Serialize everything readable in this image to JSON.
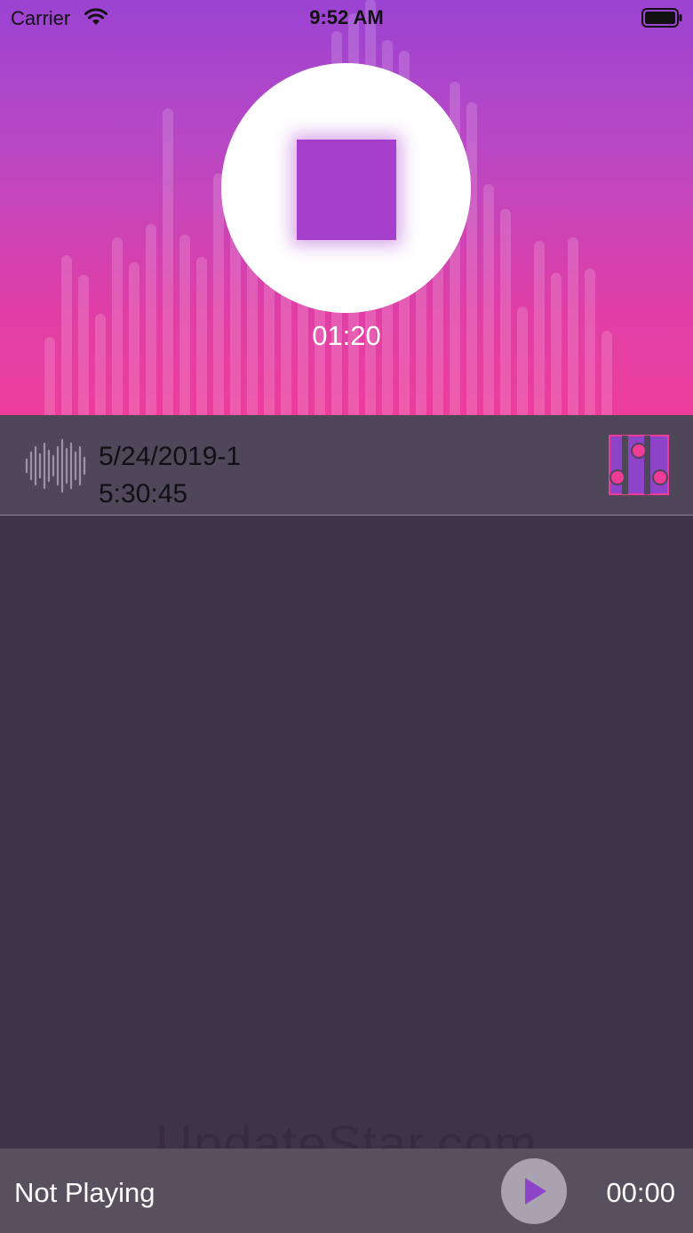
{
  "status_bar": {
    "carrier": "Carrier",
    "time": "9:52 AM",
    "icons": [
      "wifi-icon",
      "battery-icon"
    ]
  },
  "recorder": {
    "elapsed": "01:20",
    "button_icon": "stop-icon",
    "colors": {
      "gradient_top": "#9a43d2",
      "gradient_bottom": "#ec3d9d",
      "stop_square": "#a63fcb"
    }
  },
  "recordings": [
    {
      "date": "5/24/2019-1",
      "time": "5:30:45",
      "icon": "waveform-icon",
      "action_icon": "equalizer-icon"
    }
  ],
  "watermark": "UpdateStar.com",
  "player": {
    "status": "Not Playing",
    "time": "00:00",
    "button_icon": "play-icon",
    "accent": "#8e44c9"
  }
}
